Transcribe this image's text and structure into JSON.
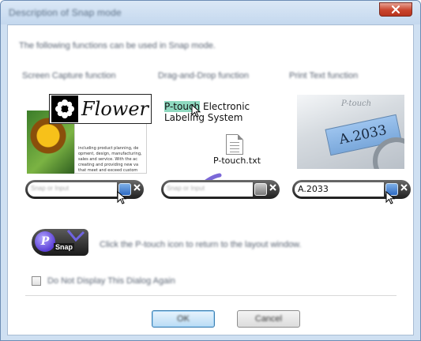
{
  "window": {
    "title": "Description of Snap mode"
  },
  "intro": "The following functions can be used in Snap mode.",
  "columns": [
    {
      "heading": "Screen Capture function"
    },
    {
      "heading": "Drag-and-Drop function"
    },
    {
      "heading": "Print Text function"
    }
  ],
  "flower_sample": {
    "word": "Flower",
    "doc_lines": [
      "including product planning, de",
      "opment, design, manufacturing,",
      "sales and service. With the ac",
      "creating and providing new va",
      "that meet and exceed custom"
    ]
  },
  "dragdrop_sample": {
    "highlighted": "P-touch",
    "line1_rest": " Electronic",
    "line2": "Labeling System",
    "file_name": "P-touch.txt"
  },
  "print_sample": {
    "brand": "P-touch",
    "label_text": "A.2033"
  },
  "snap_bars": [
    {
      "placeholder": "Snap or Input",
      "value": ""
    },
    {
      "placeholder": "Snap or Input",
      "value": ""
    },
    {
      "placeholder": "",
      "value": "A.2033"
    }
  ],
  "snap_icon": {
    "glyph": "P",
    "label": "Snap"
  },
  "snap_description": "Click the P-touch icon to return to the layout window.",
  "checkbox_label": "Do Not Display This Dialog Again",
  "buttons": {
    "ok": "OK",
    "cancel": "Cancel"
  },
  "colors": {
    "accent": "#2e6bc2",
    "highlight": "#8fd9c0",
    "close_red": "#c9442c"
  }
}
